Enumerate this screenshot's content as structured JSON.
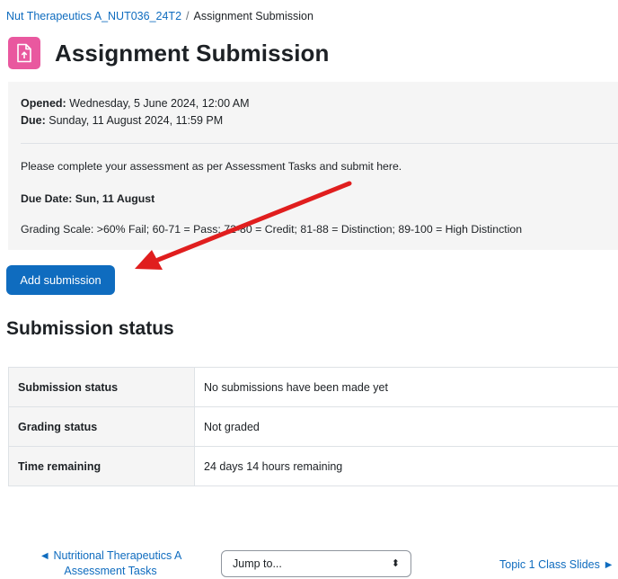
{
  "breadcrumb": {
    "course": "Nut Therapeutics A_NUT036_24T2",
    "separator": "/",
    "current": "Assignment Submission"
  },
  "page": {
    "title": "Assignment Submission",
    "icon": "assignment-upload-icon",
    "icon_color": "#e9589f"
  },
  "dates": {
    "opened_label": "Opened:",
    "opened_value": "Wednesday, 5 June 2024, 12:00 AM",
    "due_label": "Due:",
    "due_value": "Sunday, 11 August 2024, 11:59 PM"
  },
  "intro": {
    "line1": "Please complete your assessment as per Assessment Tasks and submit here.",
    "line2": "Due Date:  Sun, 11 August",
    "line3": "Grading Scale: >60% Fail; 60-71 = Pass; 72-80 = Credit; 81-88 = Distinction; 89-100 = High Distinction"
  },
  "actions": {
    "add_submission": "Add submission",
    "primary_color": "#0f6cbf"
  },
  "annotation": {
    "arrow_color": "#e01e1e"
  },
  "submission": {
    "heading": "Submission status",
    "rows": [
      {
        "label": "Submission status",
        "value": "No submissions have been made yet"
      },
      {
        "label": "Grading status",
        "value": "Not graded"
      },
      {
        "label": "Time remaining",
        "value": "24 days 14 hours remaining"
      }
    ]
  },
  "navigation": {
    "prev_arrow": "◄",
    "prev_line1": "Nutritional Therapeutics A",
    "prev_line2": "Assessment Tasks",
    "jump_placeholder": "Jump to...",
    "jump_caret": "⬍",
    "next_label": "Topic 1 Class Slides",
    "next_arrow": "►"
  }
}
